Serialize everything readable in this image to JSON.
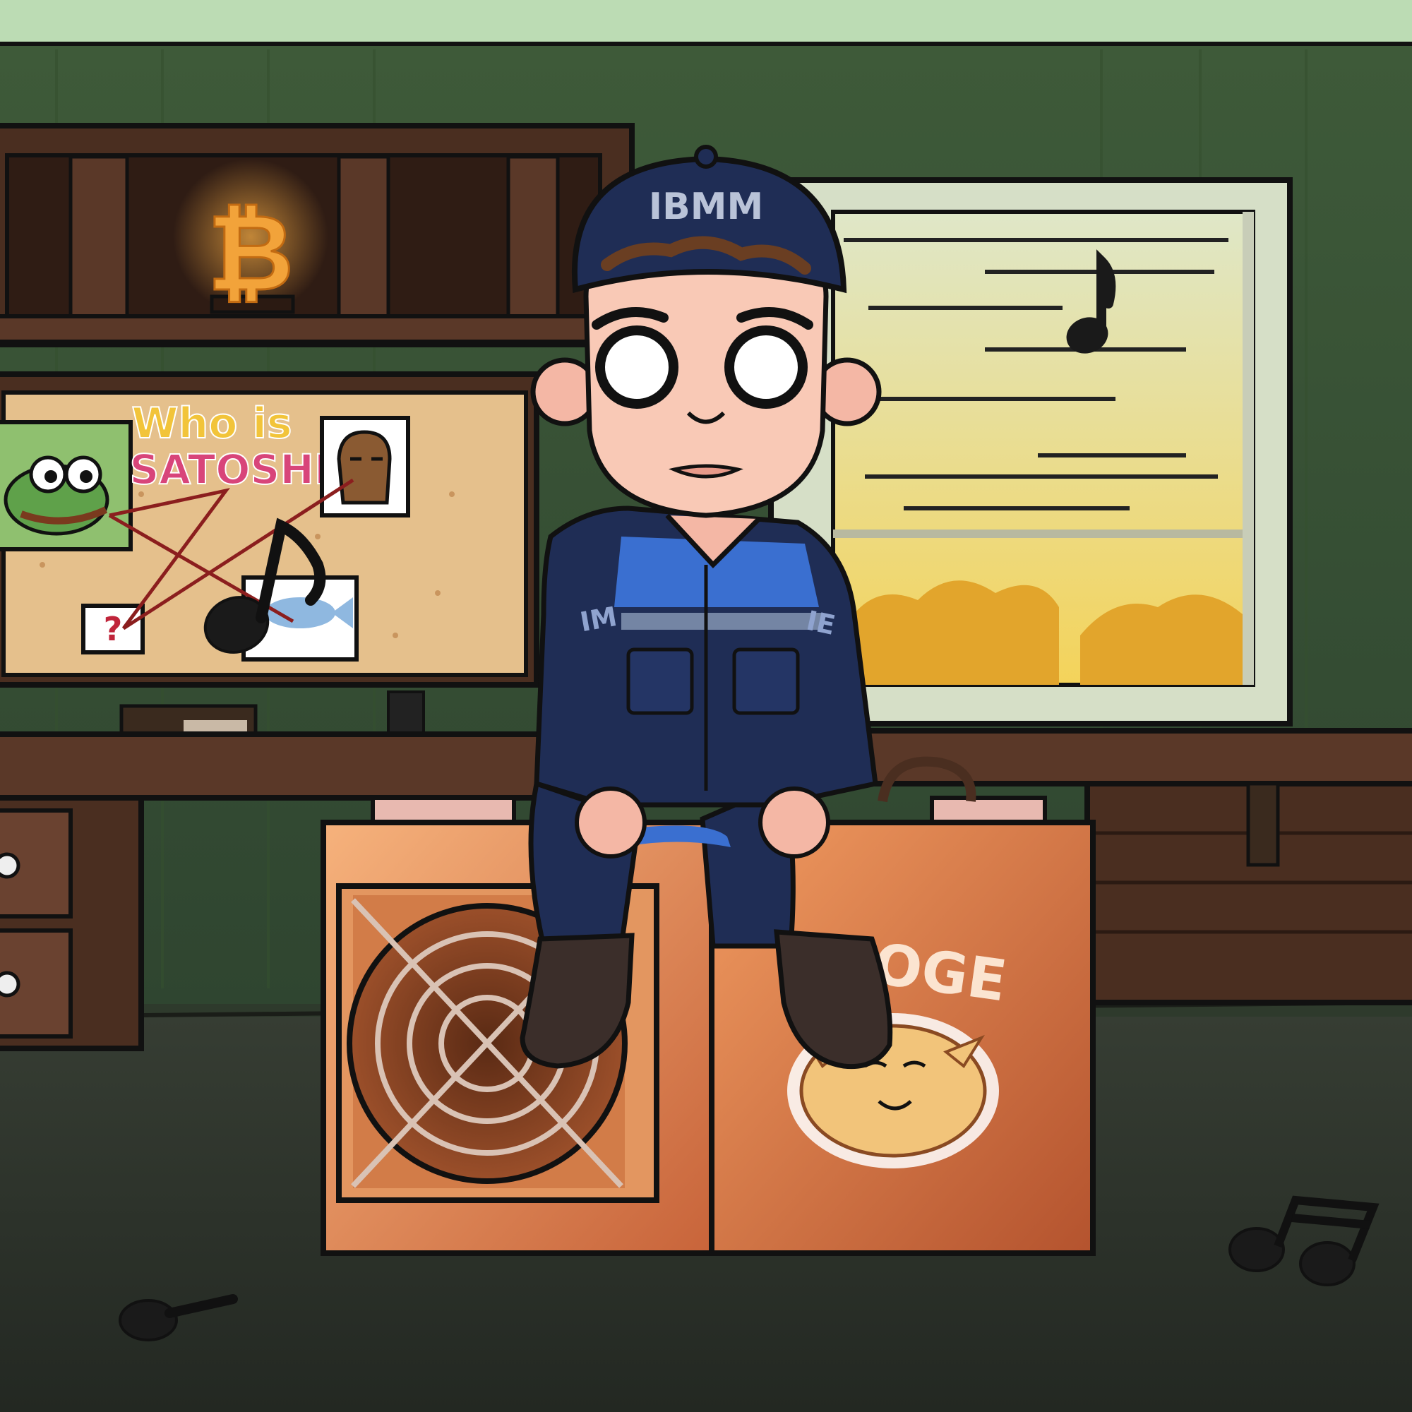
{
  "scene": {
    "description_free": true
  },
  "cap": {
    "text": "IBMM"
  },
  "sleeve": {
    "left_text": "IM",
    "right_text": "IE"
  },
  "board": {
    "line1": "Who is",
    "line2": "SATOSHI",
    "question": "?"
  },
  "miner_logo": {
    "text": "DOGE"
  },
  "icons": {
    "bitcoin_sign": "bitcoin-neon-icon",
    "notes": [
      "music-note-icon",
      "double-music-note-icon"
    ]
  },
  "colors": {
    "wall": "#3f5a3a",
    "ceiling": "#bcdcb4",
    "floor": "#2c322a",
    "uniform": "#1f2d55",
    "uniform_accent": "#3a6fd0",
    "miner": "#e08a50",
    "sunset": "#f3c94a",
    "neon": "#f2a33a"
  }
}
